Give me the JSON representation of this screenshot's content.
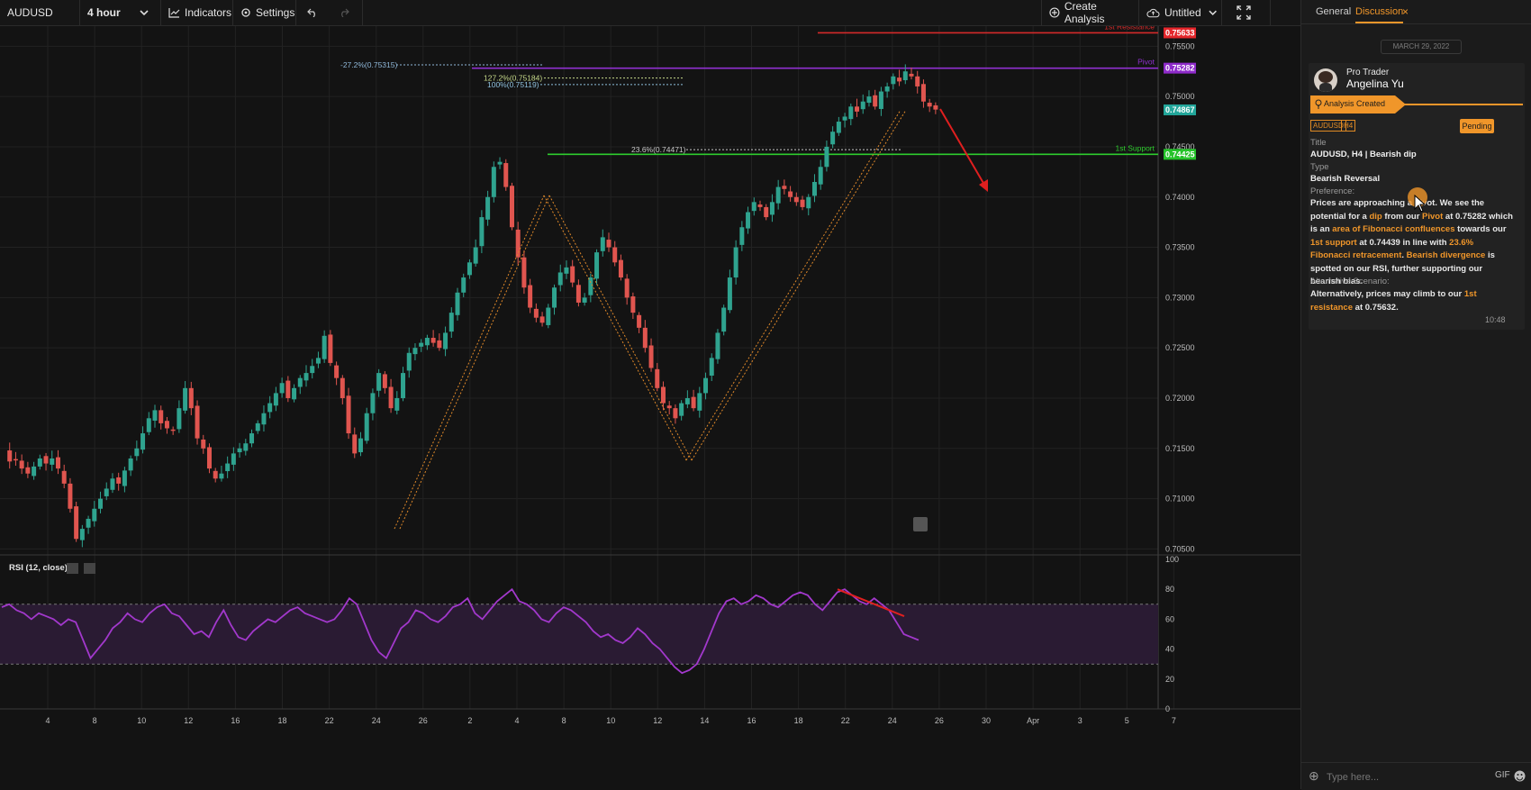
{
  "toolbar": {
    "symbol": "AUDUSD",
    "timeframe": "4 hour",
    "indicators_label": "Indicators",
    "settings_label": "Settings",
    "create_analysis_label": "Create Analysis",
    "layout_name": "Untitled"
  },
  "chart_data": {
    "type": "candlestick",
    "symbol": "AUDUSD",
    "interval": "4 hour",
    "y_ticks": [
      "0.75500",
      "0.75000",
      "0.74500",
      "0.74000",
      "0.73500",
      "0.73000",
      "0.72500",
      "0.72000",
      "0.71500",
      "0.71000",
      "0.70500"
    ],
    "x_ticks": [
      "4",
      "8",
      "10",
      "12",
      "16",
      "18",
      "22",
      "24",
      "26",
      "2",
      "4",
      "8",
      "10",
      "12",
      "14",
      "16",
      "18",
      "22",
      "24",
      "26",
      "30",
      "Apr",
      "3",
      "5",
      "7"
    ],
    "price_tags": [
      {
        "label": "0.75633",
        "color": "#e4262b"
      },
      {
        "label": "0.75282",
        "color": "#8e2bc9"
      },
      {
        "label": "0.74867",
        "color": "#22a69a"
      },
      {
        "label": "0.74425",
        "color": "#25c22a"
      }
    ],
    "levels": [
      {
        "name": "1st Resistance",
        "price": 0.75633,
        "color": "#d42a2a"
      },
      {
        "name": "Pivot",
        "price": 0.75282,
        "color": "#9030d0"
      },
      {
        "name": "1st Support",
        "price": 0.74425,
        "color": "#2ecc2e"
      }
    ],
    "fib_labels": [
      "-27.2%(0.75315)",
      "127.2%(0.75184)",
      "100%(0.75119)",
      "23.6%(0.74471)"
    ],
    "swing_points": [
      {
        "date": "Feb 24",
        "price": 0.7092
      },
      {
        "date": "Mar 7",
        "price": 0.7443
      },
      {
        "date": "Mar 15",
        "price": 0.7165
      },
      {
        "date": "Mar 27",
        "price": 0.753
      }
    ],
    "close_path": [
      [
        0,
        0.7148
      ],
      [
        0.3,
        0.7137
      ],
      [
        0.6,
        0.7139
      ],
      [
        0.9,
        0.713
      ],
      [
        1.2,
        0.7125
      ],
      [
        1.5,
        0.7132
      ],
      [
        1.8,
        0.714
      ],
      [
        2.1,
        0.7135
      ],
      [
        2.4,
        0.714
      ],
      [
        2.7,
        0.713
      ],
      [
        3,
        0.7115
      ],
      [
        3.3,
        0.709
      ],
      [
        3.6,
        0.706
      ],
      [
        3.9,
        0.707
      ],
      [
        4.2,
        0.708
      ],
      [
        4.5,
        0.709
      ],
      [
        4.8,
        0.71
      ],
      [
        5.1,
        0.711
      ],
      [
        5.4,
        0.712
      ],
      [
        5.7,
        0.7115
      ],
      [
        6,
        0.7128
      ],
      [
        6.3,
        0.714
      ],
      [
        6.6,
        0.715
      ],
      [
        6.9,
        0.7165
      ],
      [
        7.2,
        0.718
      ],
      [
        7.5,
        0.7188
      ],
      [
        7.8,
        0.7175
      ],
      [
        8.1,
        0.717
      ],
      [
        8.4,
        0.7168
      ],
      [
        8.7,
        0.719
      ],
      [
        9,
        0.721
      ],
      [
        9.3,
        0.719
      ],
      [
        9.6,
        0.716
      ],
      [
        9.9,
        0.715
      ],
      [
        10.2,
        0.713
      ],
      [
        10.5,
        0.712
      ],
      [
        10.8,
        0.7125
      ],
      [
        11.1,
        0.7135
      ],
      [
        11.4,
        0.7145
      ],
      [
        11.7,
        0.715
      ],
      [
        12,
        0.7155
      ],
      [
        12.3,
        0.7165
      ],
      [
        12.6,
        0.7175
      ],
      [
        12.9,
        0.7185
      ],
      [
        13.2,
        0.7195
      ],
      [
        13.5,
        0.7205
      ],
      [
        13.8,
        0.7215
      ],
      [
        14.1,
        0.72
      ],
      [
        14.4,
        0.721
      ],
      [
        14.7,
        0.722
      ],
      [
        15,
        0.7225
      ],
      [
        15.3,
        0.7232
      ],
      [
        15.6,
        0.724
      ],
      [
        15.9,
        0.7262
      ],
      [
        16.2,
        0.7235
      ],
      [
        16.5,
        0.722
      ],
      [
        16.8,
        0.72
      ],
      [
        17.1,
        0.7165
      ],
      [
        17.4,
        0.7145
      ],
      [
        17.7,
        0.716
      ],
      [
        18,
        0.7185
      ],
      [
        18.3,
        0.7205
      ],
      [
        18.6,
        0.7225
      ],
      [
        18.9,
        0.721
      ],
      [
        19.2,
        0.719
      ],
      [
        19.5,
        0.72
      ],
      [
        19.8,
        0.7225
      ],
      [
        20.1,
        0.7245
      ],
      [
        20.4,
        0.725
      ],
      [
        20.7,
        0.7255
      ],
      [
        21,
        0.726
      ],
      [
        21.3,
        0.7255
      ],
      [
        21.6,
        0.725
      ],
      [
        21.9,
        0.7265
      ],
      [
        22.2,
        0.7285
      ],
      [
        22.5,
        0.7305
      ],
      [
        22.8,
        0.732
      ],
      [
        23.1,
        0.7335
      ],
      [
        23.4,
        0.735
      ],
      [
        23.7,
        0.738
      ],
      [
        24,
        0.74
      ],
      [
        24.3,
        0.743
      ],
      [
        24.6,
        0.7435
      ],
      [
        24.9,
        0.741
      ],
      [
        25.2,
        0.737
      ],
      [
        25.5,
        0.734
      ],
      [
        25.8,
        0.731
      ],
      [
        26.1,
        0.729
      ],
      [
        26.4,
        0.728
      ],
      [
        26.7,
        0.7275
      ],
      [
        27,
        0.729
      ],
      [
        27.3,
        0.731
      ],
      [
        27.6,
        0.7325
      ],
      [
        27.9,
        0.733
      ],
      [
        28.2,
        0.7315
      ],
      [
        28.5,
        0.7295
      ],
      [
        28.8,
        0.73
      ],
      [
        29.1,
        0.732
      ],
      [
        29.4,
        0.7345
      ],
      [
        29.7,
        0.736
      ],
      [
        30,
        0.735
      ],
      [
        30.3,
        0.7335
      ],
      [
        30.6,
        0.732
      ],
      [
        30.9,
        0.73
      ],
      [
        31.2,
        0.7285
      ],
      [
        31.5,
        0.727
      ],
      [
        31.8,
        0.725
      ],
      [
        32.1,
        0.723
      ],
      [
        32.4,
        0.721
      ],
      [
        32.7,
        0.7195
      ],
      [
        33,
        0.719
      ],
      [
        33.3,
        0.718
      ],
      [
        33.6,
        0.7195
      ],
      [
        33.9,
        0.72
      ],
      [
        34.2,
        0.719
      ],
      [
        34.5,
        0.7205
      ],
      [
        34.8,
        0.722
      ],
      [
        35.1,
        0.724
      ],
      [
        35.4,
        0.7265
      ],
      [
        35.7,
        0.729
      ],
      [
        36,
        0.732
      ],
      [
        36.3,
        0.735
      ],
      [
        36.6,
        0.737
      ],
      [
        36.9,
        0.7385
      ],
      [
        37.2,
        0.7395
      ],
      [
        37.5,
        0.739
      ],
      [
        37.8,
        0.738
      ],
      [
        38.1,
        0.7395
      ],
      [
        38.4,
        0.741
      ],
      [
        38.7,
        0.7408
      ],
      [
        39,
        0.74
      ],
      [
        39.3,
        0.7395
      ],
      [
        39.6,
        0.739
      ],
      [
        39.9,
        0.74
      ],
      [
        40.2,
        0.7415
      ],
      [
        40.5,
        0.743
      ],
      [
        40.8,
        0.745
      ],
      [
        41.1,
        0.7465
      ],
      [
        41.4,
        0.7475
      ],
      [
        41.7,
        0.748
      ],
      [
        42,
        0.749
      ],
      [
        42.3,
        0.7485
      ],
      [
        42.6,
        0.7495
      ],
      [
        42.9,
        0.75
      ],
      [
        43.2,
        0.749
      ],
      [
        43.5,
        0.7505
      ],
      [
        43.8,
        0.751
      ],
      [
        44.1,
        0.752
      ],
      [
        44.4,
        0.7515
      ],
      [
        44.7,
        0.7525
      ],
      [
        45,
        0.752
      ],
      [
        45.3,
        0.751
      ],
      [
        45.6,
        0.7495
      ],
      [
        45.9,
        0.749
      ],
      [
        46.2,
        0.7487
      ]
    ],
    "rsi": {
      "label": "RSI (12, close)",
      "y_ticks": [
        "100",
        "80",
        "60",
        "40",
        "20",
        "0"
      ],
      "values": [
        68,
        70,
        66,
        64,
        60,
        64,
        62,
        60,
        56,
        60,
        58,
        46,
        34,
        40,
        46,
        54,
        58,
        64,
        60,
        58,
        64,
        68,
        70,
        64,
        62,
        56,
        50,
        52,
        48,
        58,
        66,
        56,
        48,
        46,
        52,
        56,
        60,
        58,
        62,
        66,
        68,
        64,
        62,
        60,
        58,
        60,
        66,
        74,
        70,
        58,
        46,
        38,
        34,
        44,
        54,
        58,
        66,
        64,
        60,
        58,
        62,
        68,
        70,
        74,
        64,
        60,
        66,
        72,
        76,
        80,
        72,
        70,
        66,
        60,
        58,
        64,
        68,
        66,
        62,
        58,
        52,
        48,
        50,
        46,
        44,
        48,
        54,
        50,
        44,
        40,
        34,
        28,
        24,
        26,
        30,
        40,
        52,
        64,
        72,
        74,
        70,
        72,
        76,
        74,
        70,
        68,
        72,
        76,
        78,
        76,
        70,
        66,
        72,
        78,
        80,
        76,
        72,
        70,
        74,
        70,
        66,
        58,
        50,
        48,
        46
      ],
      "bands": [
        70,
        30
      ],
      "divergence_color": "#e02020"
    }
  },
  "side": {
    "tab_general": "General",
    "tab_discussion": "Discussion",
    "date_chip": "MARCH 29, 2022",
    "role": "Pro Trader",
    "name": "Angelina Yu",
    "status_banner": "Analysis Created",
    "tag_symbol": "AUDUSD",
    "tag_tf": "H4",
    "pending_label": "Pending",
    "title_label": "Title",
    "title_value": "AUDUSD, H4 | Bearish dip",
    "type_label": "Type",
    "type_value": "Bearish Reversal",
    "preference_label": "Preference:",
    "alt_label": "Alternative Scenario:",
    "time": "10:48",
    "input_placeholder": "Type here...",
    "gif_label": "GIF"
  }
}
